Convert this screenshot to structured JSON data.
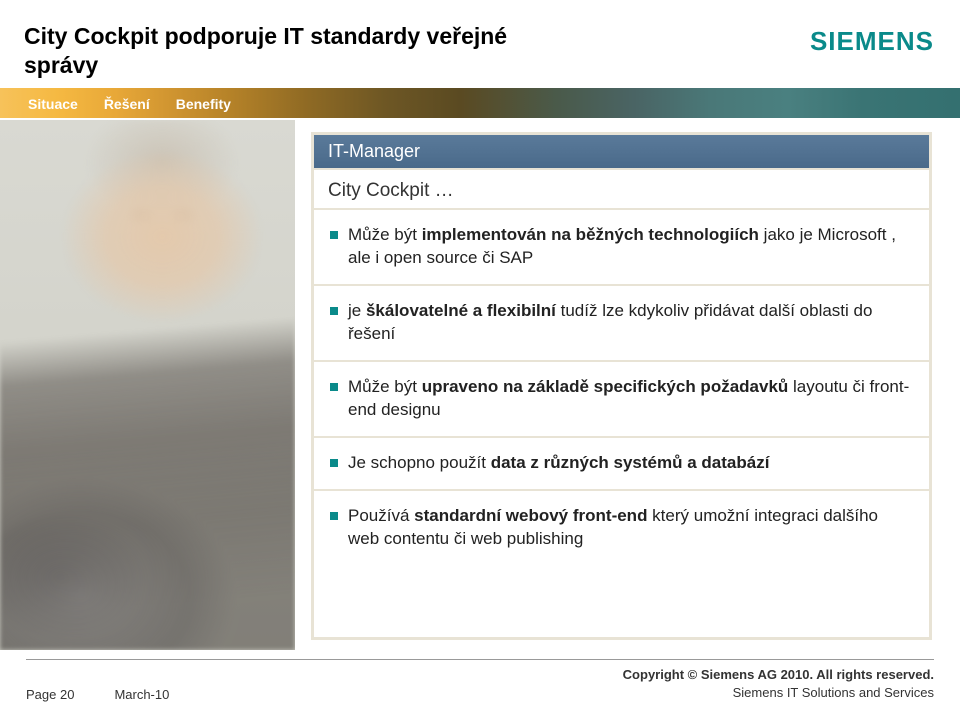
{
  "header": {
    "title": "City Cockpit podporuje IT standardy veřejné správy",
    "logo": "SIEMENS"
  },
  "tabs": {
    "t1": "Situace",
    "t2": "Řešení",
    "t3": "Benefity"
  },
  "panel": {
    "header": "IT-Manager",
    "sub": "City Cockpit …"
  },
  "rows": {
    "r1a": "Může být ",
    "r1b": "implementován na běžných technologiích",
    "r1c": " jako je Microsoft , ale i open source či SAP",
    "r2a": "je ",
    "r2b": "škálovatelné a flexibilní",
    "r2c": " tudíž lze kdykoliv přidávat další oblasti do řešení",
    "r3a": "Může  být ",
    "r3b": "upraveno na základě specifických požadavků",
    "r3c": " layoutu či front-end designu",
    "r4a": "Je schopno použít ",
    "r4b": "data z různých systémů a databází",
    "r4c": "",
    "r5a": "Používá ",
    "r5b": "standardní webový  front-end",
    "r5c": " který umožní integraci dalšího web contentu či web publishing"
  },
  "footer": {
    "page": "Page 20",
    "date": "March-10",
    "copyright": "Copyright © Siemens AG 2010. All rights reserved.",
    "org": "Siemens IT Solutions and Services"
  }
}
